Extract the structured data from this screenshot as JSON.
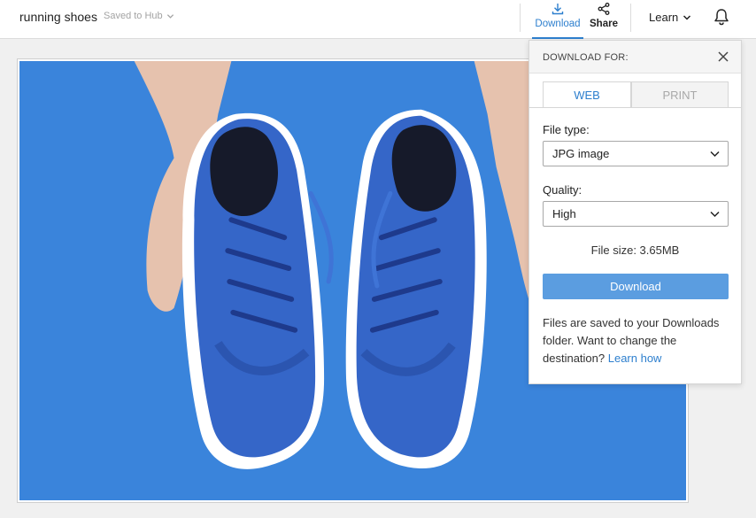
{
  "header": {
    "doc_title": "running shoes",
    "saved_status": "Saved to Hub",
    "download_label": "Download",
    "share_label": "Share",
    "learn_label": "Learn",
    "icons": [
      "chevron-down-icon",
      "download-icon",
      "share-icon",
      "bell-icon"
    ],
    "accent_color": "#2d7fce"
  },
  "panel": {
    "title": "DOWNLOAD FOR:",
    "tabs": [
      {
        "label": "WEB",
        "active": true
      },
      {
        "label": "PRINT",
        "active": false
      }
    ],
    "file_type_label": "File type:",
    "file_type_value": "JPG image",
    "quality_label": "Quality:",
    "quality_value": "High",
    "file_size": "File size: 3.65MB",
    "download_button": "Download",
    "note_text": "Files are saved to your Downloads folder. Want to change the destination? ",
    "note_link": "Learn how",
    "button_color": "#5b9de0"
  },
  "canvas": {
    "background_color": "#3a84db"
  }
}
